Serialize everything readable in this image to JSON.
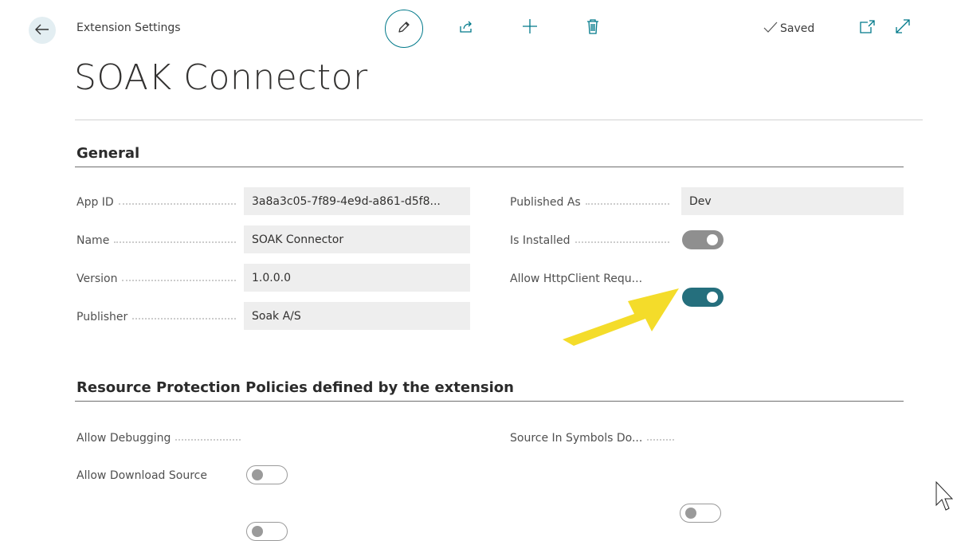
{
  "header": {
    "breadcrumb": "Extension Settings",
    "saved_label": "Saved",
    "title": "SOAK Connector"
  },
  "toolbar": {
    "icons": [
      "edit-icon",
      "share-icon",
      "new-icon",
      "delete-icon",
      "open-in-new-window-icon",
      "expand-icon"
    ]
  },
  "general": {
    "heading": "General",
    "left": [
      {
        "label": "App ID",
        "value": "3a8a3c05-7f89-4e9d-a861-d5f8..."
      },
      {
        "label": "Name",
        "value": "SOAK Connector"
      },
      {
        "label": "Version",
        "value": "1.0.0.0"
      },
      {
        "label": "Publisher",
        "value": "Soak A/S"
      }
    ],
    "right": [
      {
        "label": "Published As",
        "value": "Dev"
      },
      {
        "label": "Is Installed",
        "toggle": true,
        "state": "on-disabled"
      },
      {
        "label": "Allow HttpClient Requ...",
        "toggle": true,
        "state": "on"
      }
    ]
  },
  "resource": {
    "heading": "Resource Protection Policies defined by the extension",
    "left": [
      {
        "label": "Allow Debugging",
        "toggle": true,
        "state": "off"
      },
      {
        "label": "Allow Download Source",
        "toggle": true,
        "state": "off"
      }
    ],
    "right": [
      {
        "label": "Source In Symbols Do...",
        "toggle": true,
        "state": "off"
      }
    ]
  },
  "colors": {
    "accent": "#00798a",
    "toggle_on": "#256f7d",
    "toggle_disabled": "#8f8f8f",
    "field_bg": "#eeeeee",
    "annotation_arrow": "#f4dc2a"
  }
}
